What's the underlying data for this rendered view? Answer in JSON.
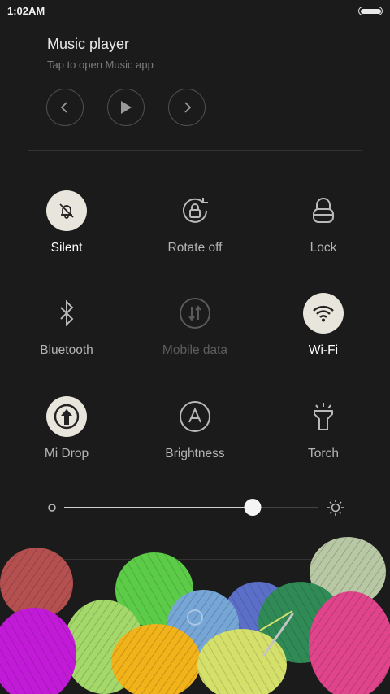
{
  "status_bar": {
    "time": "1:02AM",
    "battery_icon": "battery-full-icon"
  },
  "music_player": {
    "title": "Music player",
    "subtitle": "Tap to open Music app",
    "controls": [
      {
        "icon": "previous-icon"
      },
      {
        "icon": "play-icon"
      },
      {
        "icon": "next-icon"
      }
    ]
  },
  "quick_settings": {
    "tiles": [
      {
        "label": "Silent",
        "icon": "bell-off-icon",
        "state": "on"
      },
      {
        "label": "Rotate off",
        "icon": "rotate-lock-icon",
        "state": "off"
      },
      {
        "label": "Lock",
        "icon": "lock-icon",
        "state": "off"
      },
      {
        "label": "Bluetooth",
        "icon": "bluetooth-icon",
        "state": "off"
      },
      {
        "label": "Mobile data",
        "icon": "mobile-data-icon",
        "state": "disabled"
      },
      {
        "label": "Wi-Fi",
        "icon": "wifi-icon",
        "state": "on"
      },
      {
        "label": "Mi Drop",
        "icon": "mi-drop-icon",
        "state": "on"
      },
      {
        "label": "Brightness",
        "icon": "auto-brightness-icon",
        "state": "off"
      },
      {
        "label": "Torch",
        "icon": "torch-icon",
        "state": "off"
      }
    ]
  },
  "brightness_slider": {
    "level_percent": 74,
    "min_icon": "brightness-low-icon",
    "max_icon": "brightness-high-icon"
  },
  "colors": {
    "background": "#1b1b1b",
    "tile_on": "#e8e6dc"
  }
}
